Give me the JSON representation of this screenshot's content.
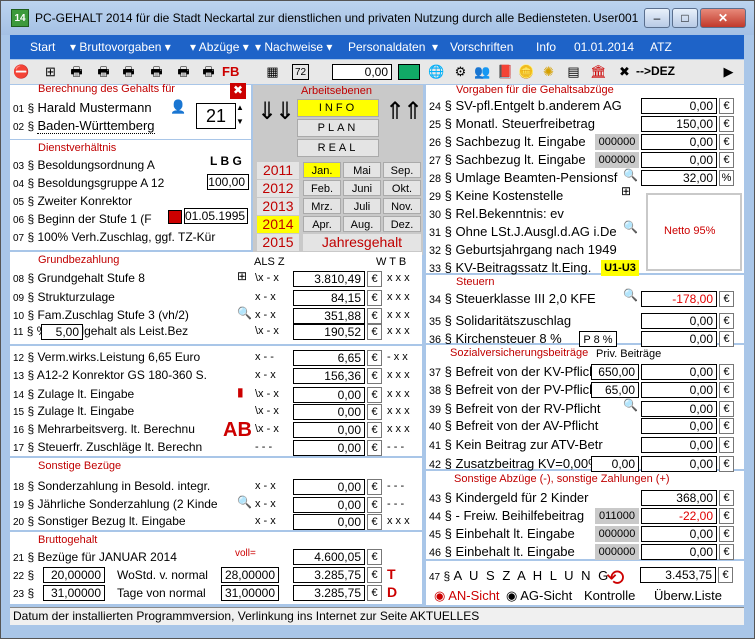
{
  "window": {
    "title": "PC-GEHALT 2014 für die Stadt Neckartal zur dienstlichen und privaten Nutzung durch alle Bediensteten.",
    "user": "User001",
    "app_icon": "14",
    "min": "–",
    "max": "□",
    "close": "✕"
  },
  "menu": [
    "Start",
    "Bruttovorgaben",
    "Abzüge",
    "Nachweise",
    "Personaldaten",
    "Vorschriften",
    "Info",
    "01.01.2014",
    "ATZ"
  ],
  "toolbar": {
    "input": "0,00",
    "dez": "-->DEZ"
  },
  "berechnung": {
    "header": "Berechnung des Gehalts für",
    "rows": [
      {
        "n": "01",
        "t": "Harald Mustermann"
      },
      {
        "n": "02",
        "t": "Baden-Württemberg"
      }
    ],
    "day": "21"
  },
  "arbeitsebenen": {
    "header": "Arbeitsebenen",
    "buttons": [
      "INFO",
      "PLAN",
      "REAL"
    ]
  },
  "years": [
    "2011",
    "2012",
    "2013",
    "2014",
    "2015"
  ],
  "months": [
    [
      "Jan.",
      "Mai",
      "Sep."
    ],
    [
      "Feb.",
      "Juni",
      "Okt."
    ],
    [
      "Mrz.",
      "Juli",
      "Nov."
    ],
    [
      "Apr.",
      "Aug.",
      "Dez."
    ]
  ],
  "jahresgehalt": "Jahresgehalt",
  "dienst": {
    "header": "Dienstverhältnis",
    "rows": [
      {
        "n": "03",
        "t": "Besoldungsordnung A"
      },
      {
        "n": "04",
        "t": "Besoldungsgruppe A 12"
      },
      {
        "n": "05",
        "t": "Zweiter Konrektor"
      },
      {
        "n": "06",
        "t": "Beginn der Stufe 1 (F"
      },
      {
        "n": "07",
        "t": "100% Verh.Zuschlag, ggf. TZ-Kür"
      }
    ],
    "lbg": "L B G",
    "pct": "100,00",
    "date": "01.05.1995"
  },
  "grund": {
    "header": "Grundbezahlung",
    "cols": "ALS Z",
    "cols2": "W T B",
    "rows": [
      {
        "n": "08",
        "t": "Grundgehalt Stufe 8",
        "f": "\\x - x",
        "v": "3.810,49",
        "w": "x x x"
      },
      {
        "n": "09",
        "t": "Strukturzulage",
        "f": "x - x",
        "v": "84,15",
        "w": "x x x"
      },
      {
        "n": "10",
        "t": "Fam.Zuschlag Stufe 3 (vh/2)",
        "f": "x - x",
        "v": "351,88",
        "w": "x x x"
      },
      {
        "n": "11",
        "t": "% Grundgehalt als Leist.Bez",
        "f": "\\x - x",
        "v": "190,52",
        "w": "x x x",
        "pct": "5,00"
      }
    ]
  },
  "zulagen": {
    "rows": [
      {
        "n": "12",
        "t": "Verm.wirks.Leistung   6,65 Euro",
        "f": "x - -",
        "v": "6,65",
        "w": "- x x"
      },
      {
        "n": "13",
        "t": "A12-2 Konrektor GS 180-360 S.",
        "f": "x - x",
        "v": "156,36",
        "w": "x x x"
      },
      {
        "n": "14",
        "t": "Zulage lt. Eingabe",
        "f": "\\x - x",
        "v": "0,00",
        "w": "x x x"
      },
      {
        "n": "15",
        "t": "Zulage lt. Eingabe",
        "f": "\\x - x",
        "v": "0,00",
        "w": "x x x"
      },
      {
        "n": "16",
        "t": "Mehrarbeitsverg. lt. Berechnu",
        "f": "\\x - x",
        "v": "0,00",
        "w": "x x x"
      },
      {
        "n": "17",
        "t": "Steuerfr. Zuschläge lt. Berechn",
        "f": "- - -",
        "v": "0,00",
        "w": "- - -"
      }
    ]
  },
  "sonstige": {
    "header": "Sonstige Bezüge",
    "rows": [
      {
        "n": "18",
        "t": "Sonderzahlung in Besold. integr.",
        "f": "x - x",
        "v": "0,00",
        "w": "- - -"
      },
      {
        "n": "19",
        "t": "Jährliche Sonderzahlung (2 Kinde",
        "f": "x - x",
        "v": "0,00",
        "w": "- - -"
      },
      {
        "n": "20",
        "t": "Sonstiger Bezug lt. Eingabe",
        "f": "x - x",
        "v": "0,00",
        "w": "x x x"
      }
    ]
  },
  "brutto": {
    "header": "Bruttogehalt",
    "n21": "21",
    "t21": "Bezüge für JANUAR  2014",
    "voll": "voll=",
    "v21": "4.600,05",
    "n22": "22",
    "v22a": "20,00000",
    "t22": "WoStd. v. normal",
    "v22b": "28,00000",
    "v22": "3.285,75",
    "n23": "23",
    "v23a": "31,00000",
    "t23": "Tage von normal",
    "v23b": "31,00000",
    "v23": "3.285,75"
  },
  "vorgaben": {
    "header": "Vorgaben für die Gehaltsabzüge",
    "rows": [
      {
        "n": "24",
        "t": "SV-pfl.Entgelt b.anderem AG",
        "v": "0,00"
      },
      {
        "n": "25",
        "t": "Monatl. Steuerfreibetrag",
        "v": "150,00"
      },
      {
        "n": "26",
        "t": "Sachbezug lt. Eingabe",
        "g": "000000",
        "v": "0,00"
      },
      {
        "n": "27",
        "t": "Sachbezug lt. Eingabe",
        "g": "000000",
        "v": "0,00"
      },
      {
        "n": "28",
        "t": "Umlage Beamten-Pensionsf",
        "v": "32,00",
        "u": "%"
      },
      {
        "n": "29",
        "t": "Keine Kostenstelle"
      },
      {
        "n": "30",
        "t": "Rel.Bekenntnis: ev"
      },
      {
        "n": "31",
        "t": "Ohne LSt.J.Ausgl.d.AG i.De"
      },
      {
        "n": "32",
        "t": "Geburtsjahrgang nach 1949"
      },
      {
        "n": "33",
        "t": "KV-Beitragssatz lt.Eing.",
        "badge": "U1-U3"
      }
    ],
    "netto": "Netto  95%"
  },
  "steuern": {
    "header": "Steuern",
    "rows": [
      {
        "n": "34",
        "t": "Steuerklasse III    2,0 KFE",
        "v": "-178,00",
        "red": true
      },
      {
        "n": "35",
        "t": "Solidaritätszuschlag",
        "v": "0,00"
      },
      {
        "n": "36",
        "t": "Kirchensteuer 8 %",
        "v": "0,00",
        "btn": "P 8 %"
      }
    ]
  },
  "sv": {
    "header": "Sozialversicherungsbeiträge",
    "priv": "Priv. Beiträge",
    "rows": [
      {
        "n": "37",
        "t": "Befreit von der KV-Pflich",
        "p": "650,00",
        "v": "0,00"
      },
      {
        "n": "38",
        "t": "Befreit von der PV-Pflich",
        "p": "65,00",
        "v": "0,00"
      },
      {
        "n": "39",
        "t": "Befreit von der RV-Pflicht",
        "v": "0,00"
      },
      {
        "n": "40",
        "t": "Befreit von der AV-Pflicht",
        "v": "0,00"
      },
      {
        "n": "41",
        "t": "Kein Beitrag zur ATV-Betr",
        "v": "0,00",
        "btn": "U"
      },
      {
        "n": "42",
        "t": "Zusatzbeitrag KV=0,00%, PV=",
        "p": "0,00",
        "v": "0,00"
      }
    ]
  },
  "abzuege": {
    "header": "Sonstige Abzüge (-), sonstige Zahlungen (+)",
    "rows": [
      {
        "n": "43",
        "t": "Kindergeld für 2 Kinder",
        "v": "368,00"
      },
      {
        "n": "44",
        "t": "- Freiw. Beihilfebeitrag",
        "g": "011000",
        "v": "-22,00",
        "red": true
      },
      {
        "n": "45",
        "t": "Einbehalt lt. Eingabe",
        "g": "000000",
        "v": "0,00"
      },
      {
        "n": "46",
        "t": "Einbehalt lt. Eingabe",
        "g": "000000",
        "v": "0,00"
      }
    ]
  },
  "auszahlung": {
    "n": "47",
    "t": "A U S Z A H L U N G",
    "v": "3.453,75"
  },
  "bottom": {
    "an": "AN-Sicht",
    "ag": "AG-Sicht",
    "kontrolle": "Kontrolle",
    "ueberw": "Überw.Liste"
  },
  "euro": "€",
  "status": "Datum der installierten Programmversion, Verlinkung ins Internet zur Seite AKTUELLES"
}
